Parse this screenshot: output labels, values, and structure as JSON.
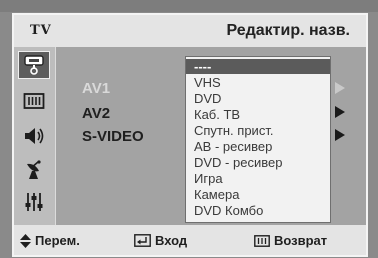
{
  "header": {
    "mode": "TV",
    "title": "Редактир. назв."
  },
  "sidebar": {
    "icons": [
      "input-icon",
      "picture-icon",
      "sound-icon",
      "channel-icon",
      "setup-icon"
    ]
  },
  "sources": [
    {
      "label": "AV1"
    },
    {
      "label": "AV2"
    },
    {
      "label": "S-VIDEO"
    }
  ],
  "dropdown": {
    "items": [
      "----",
      "VHS",
      "DVD",
      "Каб. ТВ",
      "Спутн. прист.",
      "AB - ресивер",
      "DVD - ресивер",
      "Игра",
      "Камера",
      "DVD Комбо"
    ]
  },
  "footer": {
    "move_label": "Перем.",
    "enter_label": "Вход",
    "return_label": "Возврат"
  }
}
